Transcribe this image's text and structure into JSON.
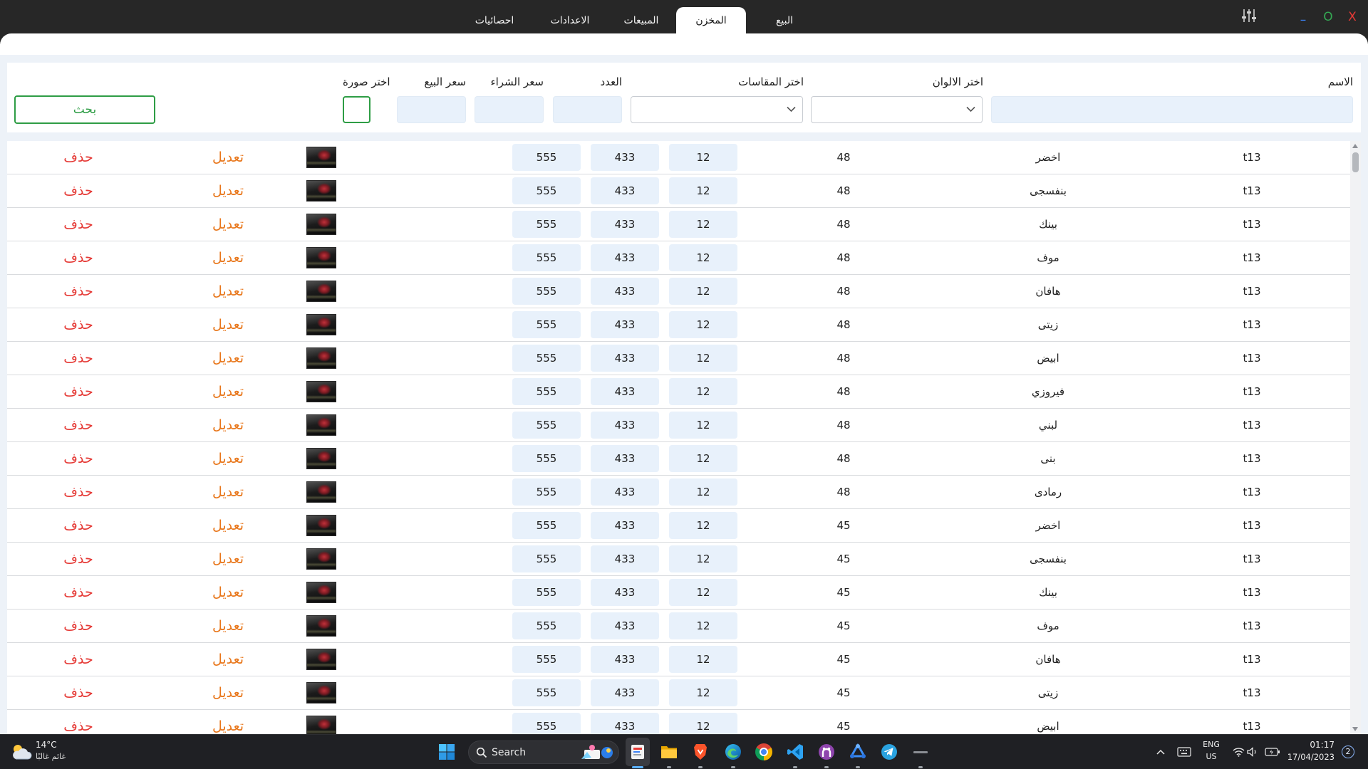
{
  "window": {
    "tabs": [
      {
        "label": "البيع",
        "active": false
      },
      {
        "label": "المخزن",
        "active": true
      },
      {
        "label": "المبيعات",
        "active": false
      },
      {
        "label": "الاعدادات",
        "active": false
      },
      {
        "label": "احصائيات",
        "active": false
      }
    ],
    "settings_icon": "sliders-icon",
    "controls": {
      "minimize": "–",
      "maximize": "O",
      "close": "X"
    }
  },
  "form": {
    "name_label": "الاسم",
    "colors_label": "اختر الالوان",
    "sizes_label": "اختر المقاسات",
    "count_label": "العدد",
    "buy_price_label": "سعر الشراء",
    "sell_price_label": "سعر البيع",
    "image_label": "اختر صورة",
    "search_button_label": "بحث"
  },
  "table": {
    "edit_label": "تعديل",
    "delete_label": "حذف",
    "rows": [
      {
        "name": "t13",
        "color": "اخضر",
        "size": "48",
        "count": "12",
        "buy_price": "433",
        "sell_price": "555"
      },
      {
        "name": "t13",
        "color": "بنفسجى",
        "size": "48",
        "count": "12",
        "buy_price": "433",
        "sell_price": "555"
      },
      {
        "name": "t13",
        "color": "بينك",
        "size": "48",
        "count": "12",
        "buy_price": "433",
        "sell_price": "555"
      },
      {
        "name": "t13",
        "color": "موف",
        "size": "48",
        "count": "12",
        "buy_price": "433",
        "sell_price": "555"
      },
      {
        "name": "t13",
        "color": "هافان",
        "size": "48",
        "count": "12",
        "buy_price": "433",
        "sell_price": "555"
      },
      {
        "name": "t13",
        "color": "زيتى",
        "size": "48",
        "count": "12",
        "buy_price": "433",
        "sell_price": "555"
      },
      {
        "name": "t13",
        "color": "ابيض",
        "size": "48",
        "count": "12",
        "buy_price": "433",
        "sell_price": "555"
      },
      {
        "name": "t13",
        "color": "فيروزي",
        "size": "48",
        "count": "12",
        "buy_price": "433",
        "sell_price": "555"
      },
      {
        "name": "t13",
        "color": "لبني",
        "size": "48",
        "count": "12",
        "buy_price": "433",
        "sell_price": "555"
      },
      {
        "name": "t13",
        "color": "بنى",
        "size": "48",
        "count": "12",
        "buy_price": "433",
        "sell_price": "555"
      },
      {
        "name": "t13",
        "color": "رمادى",
        "size": "48",
        "count": "12",
        "buy_price": "433",
        "sell_price": "555"
      },
      {
        "name": "t13",
        "color": "اخضر",
        "size": "45",
        "count": "12",
        "buy_price": "433",
        "sell_price": "555"
      },
      {
        "name": "t13",
        "color": "بنفسجى",
        "size": "45",
        "count": "12",
        "buy_price": "433",
        "sell_price": "555"
      },
      {
        "name": "t13",
        "color": "بينك",
        "size": "45",
        "count": "12",
        "buy_price": "433",
        "sell_price": "555"
      },
      {
        "name": "t13",
        "color": "موف",
        "size": "45",
        "count": "12",
        "buy_price": "433",
        "sell_price": "555"
      },
      {
        "name": "t13",
        "color": "هافان",
        "size": "45",
        "count": "12",
        "buy_price": "433",
        "sell_price": "555"
      },
      {
        "name": "t13",
        "color": "زيتى",
        "size": "45",
        "count": "12",
        "buy_price": "433",
        "sell_price": "555"
      },
      {
        "name": "t13",
        "color": "ابيض",
        "size": "45",
        "count": "12",
        "buy_price": "433",
        "sell_price": "555"
      }
    ]
  },
  "taskbar": {
    "weather": {
      "temperature": "14°C",
      "condition": "غائم غالبًا",
      "icon": "partly-cloudy-icon"
    },
    "search_placeholder": "Search",
    "apps": [
      "start-icon",
      "running-app-icon",
      "file-explorer-icon",
      "brave-icon",
      "edge-icon",
      "chrome-icon",
      "vscode-icon",
      "github-desktop-icon",
      "blue-app-icon",
      "telegram-icon",
      "minimized-app-icon"
    ],
    "tray": {
      "language": "ENG",
      "region": "US",
      "time": "01:17",
      "date": "17/04/2023",
      "notifications": "2"
    }
  },
  "colors": {
    "titlebar": "#272727",
    "accent_green": "#2e9d45",
    "edit": "#e8761a",
    "delete": "#e53935",
    "minimize": "#3b82f6",
    "maximize": "#34a853",
    "close": "#e53935",
    "input_bg": "#e8f1fb"
  }
}
